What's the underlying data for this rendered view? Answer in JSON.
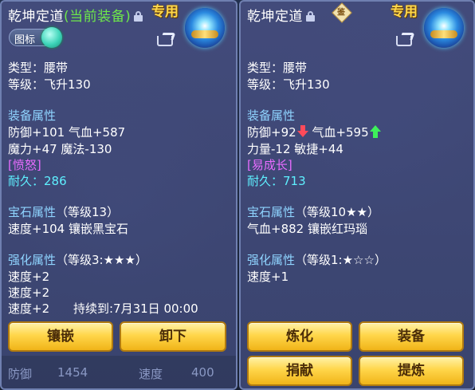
{
  "left": {
    "title": "乾坤定道",
    "equipped_label": "(当前装备)",
    "exclusive": "专用",
    "toggle_label": "图标",
    "type": "类型：腰带",
    "level": "等级：飞升130",
    "attr_header": "装备属性",
    "attr1": "防御+101 气血+587",
    "attr2": "魔力+47 魔法-130",
    "special": "[愤怒]",
    "durability": "耐久：286",
    "gem_header": "宝石属性",
    "gem_level": "（等级13）",
    "gem_desc": "速度+104 镶嵌黑宝石",
    "enhance_header": "强化属性",
    "enhance_level": "（等级3:★★★）",
    "enhance1": "速度+2",
    "enhance2": "速度+2",
    "enhance3": "速度+2",
    "duration": "持续到:7月31日 00:00",
    "btn_inlay": "镶嵌",
    "btn_unequip": "卸下",
    "bg_stat_label": "防御",
    "bg_stat_value": "1454",
    "bg_stat2_label": "速度",
    "bg_stat2_value": "400"
  },
  "right": {
    "title": "乾坤定道",
    "appraise_glyph": "鉴",
    "exclusive": "专用",
    "type": "类型：腰带",
    "level": "等级：飞升130",
    "attr_header": "装备属性",
    "attr1_a": "防御+92",
    "attr1_b": "气血+595",
    "attr2": "力量-12 敏捷+44",
    "special": "[易成长]",
    "durability": "耐久：713",
    "gem_header": "宝石属性",
    "gem_level": "（等级10★★）",
    "gem_desc": "气血+882 镶嵌红玛瑙",
    "enhance_header": "强化属性",
    "enhance_level": "（等级1:★☆☆）",
    "enhance1": "速度+1",
    "btn_refine": "炼化",
    "btn_equip": "装备",
    "btn_donate": "捐献",
    "btn_extract": "提炼"
  }
}
